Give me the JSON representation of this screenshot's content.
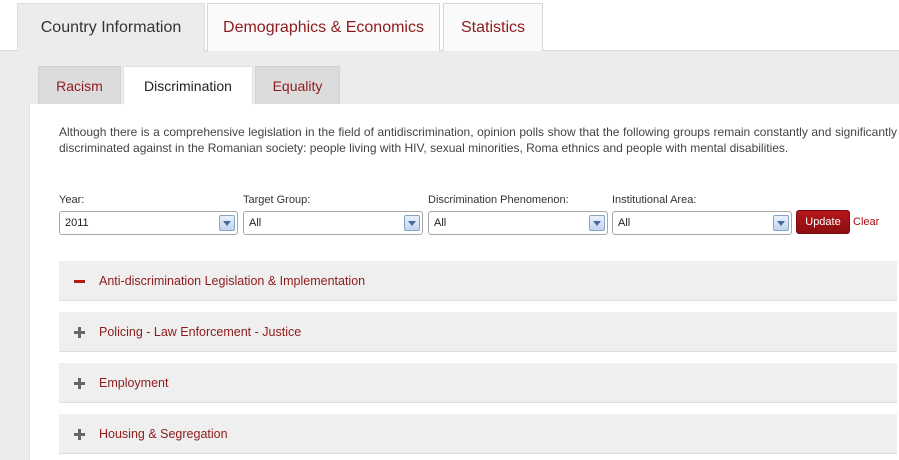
{
  "top_tabs": [
    {
      "label": "Country Information",
      "active": true
    },
    {
      "label": "Demographics & Economics",
      "active": false
    },
    {
      "label": "Statistics",
      "active": false
    }
  ],
  "sub_tabs": [
    {
      "label": "Racism",
      "active": false
    },
    {
      "label": "Discrimination",
      "active": true
    },
    {
      "label": "Equality",
      "active": false
    }
  ],
  "intro_text": "Although there is a comprehensive legislation in the field of antidiscrimination, opinion polls show that the following groups remain constantly and significantly discriminated against in the Romanian society: people living with HIV, sexual minorities, Roma ethnics and people with mental disabilities.",
  "filters": [
    {
      "label": "Year:",
      "value": "2011"
    },
    {
      "label": "Target Group:",
      "value": "All"
    },
    {
      "label": "Discrimination Phenomenon:",
      "value": "All"
    },
    {
      "label": "Institutional Area:",
      "value": "All"
    }
  ],
  "buttons": {
    "update": "Update",
    "clear": "Clear"
  },
  "accordion": [
    {
      "title": "Anti-discrimination Legislation & Implementation",
      "expanded": true
    },
    {
      "title": "Policing - Law Enforcement - Justice",
      "expanded": false
    },
    {
      "title": "Employment",
      "expanded": false
    },
    {
      "title": "Housing & Segregation",
      "expanded": false
    }
  ],
  "colors": {
    "accent": "#8e1b1b",
    "button": "#a01418",
    "panel": "#ececec"
  }
}
